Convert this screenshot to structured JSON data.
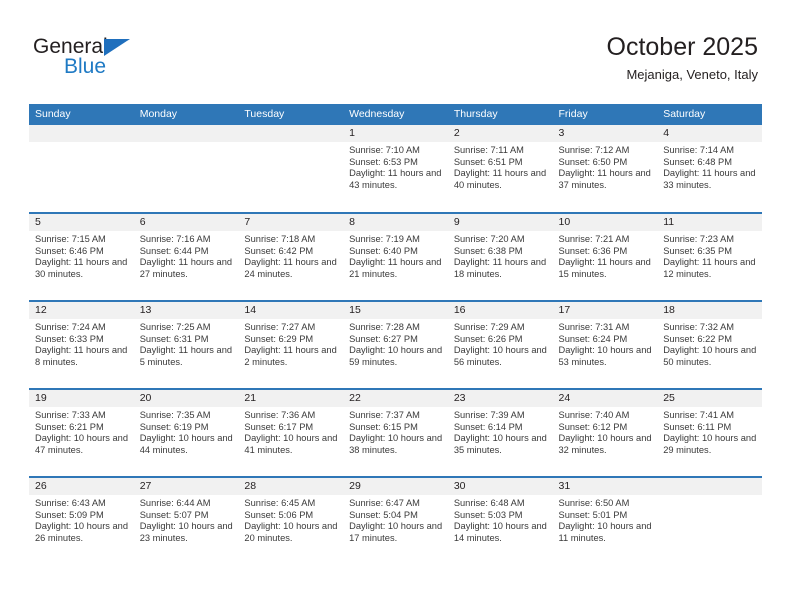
{
  "brand": {
    "name_part1": "General",
    "name_part2": "Blue",
    "triangle_color": "#1f6fbd",
    "blue_text_color": "#1f7ac4"
  },
  "header": {
    "title": "October 2025",
    "subtitle": "Mejaniga, Veneto, Italy"
  },
  "theme": {
    "header_blue": "#2f77b7",
    "daynum_band": "#f1f1f1",
    "text": "#231f20"
  },
  "weekday_headers": [
    "Sunday",
    "Monday",
    "Tuesday",
    "Wednesday",
    "Thursday",
    "Friday",
    "Saturday"
  ],
  "labels": {
    "sunrise_prefix": "Sunrise:",
    "sunset_prefix": "Sunset:",
    "daylight_prefix": "Daylight:"
  },
  "weeks": [
    [
      {
        "day": "",
        "empty": true
      },
      {
        "day": "",
        "empty": true
      },
      {
        "day": "",
        "empty": true
      },
      {
        "day": "1",
        "sunrise": "Sunrise: 7:10 AM",
        "sunset": "Sunset: 6:53 PM",
        "daylight": "Daylight: 11 hours and 43 minutes."
      },
      {
        "day": "2",
        "sunrise": "Sunrise: 7:11 AM",
        "sunset": "Sunset: 6:51 PM",
        "daylight": "Daylight: 11 hours and 40 minutes."
      },
      {
        "day": "3",
        "sunrise": "Sunrise: 7:12 AM",
        "sunset": "Sunset: 6:50 PM",
        "daylight": "Daylight: 11 hours and 37 minutes."
      },
      {
        "day": "4",
        "sunrise": "Sunrise: 7:14 AM",
        "sunset": "Sunset: 6:48 PM",
        "daylight": "Daylight: 11 hours and 33 minutes."
      }
    ],
    [
      {
        "day": "5",
        "sunrise": "Sunrise: 7:15 AM",
        "sunset": "Sunset: 6:46 PM",
        "daylight": "Daylight: 11 hours and 30 minutes."
      },
      {
        "day": "6",
        "sunrise": "Sunrise: 7:16 AM",
        "sunset": "Sunset: 6:44 PM",
        "daylight": "Daylight: 11 hours and 27 minutes."
      },
      {
        "day": "7",
        "sunrise": "Sunrise: 7:18 AM",
        "sunset": "Sunset: 6:42 PM",
        "daylight": "Daylight: 11 hours and 24 minutes."
      },
      {
        "day": "8",
        "sunrise": "Sunrise: 7:19 AM",
        "sunset": "Sunset: 6:40 PM",
        "daylight": "Daylight: 11 hours and 21 minutes."
      },
      {
        "day": "9",
        "sunrise": "Sunrise: 7:20 AM",
        "sunset": "Sunset: 6:38 PM",
        "daylight": "Daylight: 11 hours and 18 minutes."
      },
      {
        "day": "10",
        "sunrise": "Sunrise: 7:21 AM",
        "sunset": "Sunset: 6:36 PM",
        "daylight": "Daylight: 11 hours and 15 minutes."
      },
      {
        "day": "11",
        "sunrise": "Sunrise: 7:23 AM",
        "sunset": "Sunset: 6:35 PM",
        "daylight": "Daylight: 11 hours and 12 minutes."
      }
    ],
    [
      {
        "day": "12",
        "sunrise": "Sunrise: 7:24 AM",
        "sunset": "Sunset: 6:33 PM",
        "daylight": "Daylight: 11 hours and 8 minutes."
      },
      {
        "day": "13",
        "sunrise": "Sunrise: 7:25 AM",
        "sunset": "Sunset: 6:31 PM",
        "daylight": "Daylight: 11 hours and 5 minutes."
      },
      {
        "day": "14",
        "sunrise": "Sunrise: 7:27 AM",
        "sunset": "Sunset: 6:29 PM",
        "daylight": "Daylight: 11 hours and 2 minutes."
      },
      {
        "day": "15",
        "sunrise": "Sunrise: 7:28 AM",
        "sunset": "Sunset: 6:27 PM",
        "daylight": "Daylight: 10 hours and 59 minutes."
      },
      {
        "day": "16",
        "sunrise": "Sunrise: 7:29 AM",
        "sunset": "Sunset: 6:26 PM",
        "daylight": "Daylight: 10 hours and 56 minutes."
      },
      {
        "day": "17",
        "sunrise": "Sunrise: 7:31 AM",
        "sunset": "Sunset: 6:24 PM",
        "daylight": "Daylight: 10 hours and 53 minutes."
      },
      {
        "day": "18",
        "sunrise": "Sunrise: 7:32 AM",
        "sunset": "Sunset: 6:22 PM",
        "daylight": "Daylight: 10 hours and 50 minutes."
      }
    ],
    [
      {
        "day": "19",
        "sunrise": "Sunrise: 7:33 AM",
        "sunset": "Sunset: 6:21 PM",
        "daylight": "Daylight: 10 hours and 47 minutes."
      },
      {
        "day": "20",
        "sunrise": "Sunrise: 7:35 AM",
        "sunset": "Sunset: 6:19 PM",
        "daylight": "Daylight: 10 hours and 44 minutes."
      },
      {
        "day": "21",
        "sunrise": "Sunrise: 7:36 AM",
        "sunset": "Sunset: 6:17 PM",
        "daylight": "Daylight: 10 hours and 41 minutes."
      },
      {
        "day": "22",
        "sunrise": "Sunrise: 7:37 AM",
        "sunset": "Sunset: 6:15 PM",
        "daylight": "Daylight: 10 hours and 38 minutes."
      },
      {
        "day": "23",
        "sunrise": "Sunrise: 7:39 AM",
        "sunset": "Sunset: 6:14 PM",
        "daylight": "Daylight: 10 hours and 35 minutes."
      },
      {
        "day": "24",
        "sunrise": "Sunrise: 7:40 AM",
        "sunset": "Sunset: 6:12 PM",
        "daylight": "Daylight: 10 hours and 32 minutes."
      },
      {
        "day": "25",
        "sunrise": "Sunrise: 7:41 AM",
        "sunset": "Sunset: 6:11 PM",
        "daylight": "Daylight: 10 hours and 29 minutes."
      }
    ],
    [
      {
        "day": "26",
        "sunrise": "Sunrise: 6:43 AM",
        "sunset": "Sunset: 5:09 PM",
        "daylight": "Daylight: 10 hours and 26 minutes."
      },
      {
        "day": "27",
        "sunrise": "Sunrise: 6:44 AM",
        "sunset": "Sunset: 5:07 PM",
        "daylight": "Daylight: 10 hours and 23 minutes."
      },
      {
        "day": "28",
        "sunrise": "Sunrise: 6:45 AM",
        "sunset": "Sunset: 5:06 PM",
        "daylight": "Daylight: 10 hours and 20 minutes."
      },
      {
        "day": "29",
        "sunrise": "Sunrise: 6:47 AM",
        "sunset": "Sunset: 5:04 PM",
        "daylight": "Daylight: 10 hours and 17 minutes."
      },
      {
        "day": "30",
        "sunrise": "Sunrise: 6:48 AM",
        "sunset": "Sunset: 5:03 PM",
        "daylight": "Daylight: 10 hours and 14 minutes."
      },
      {
        "day": "31",
        "sunrise": "Sunrise: 6:50 AM",
        "sunset": "Sunset: 5:01 PM",
        "daylight": "Daylight: 10 hours and 11 minutes."
      },
      {
        "day": "",
        "empty": true
      }
    ]
  ]
}
